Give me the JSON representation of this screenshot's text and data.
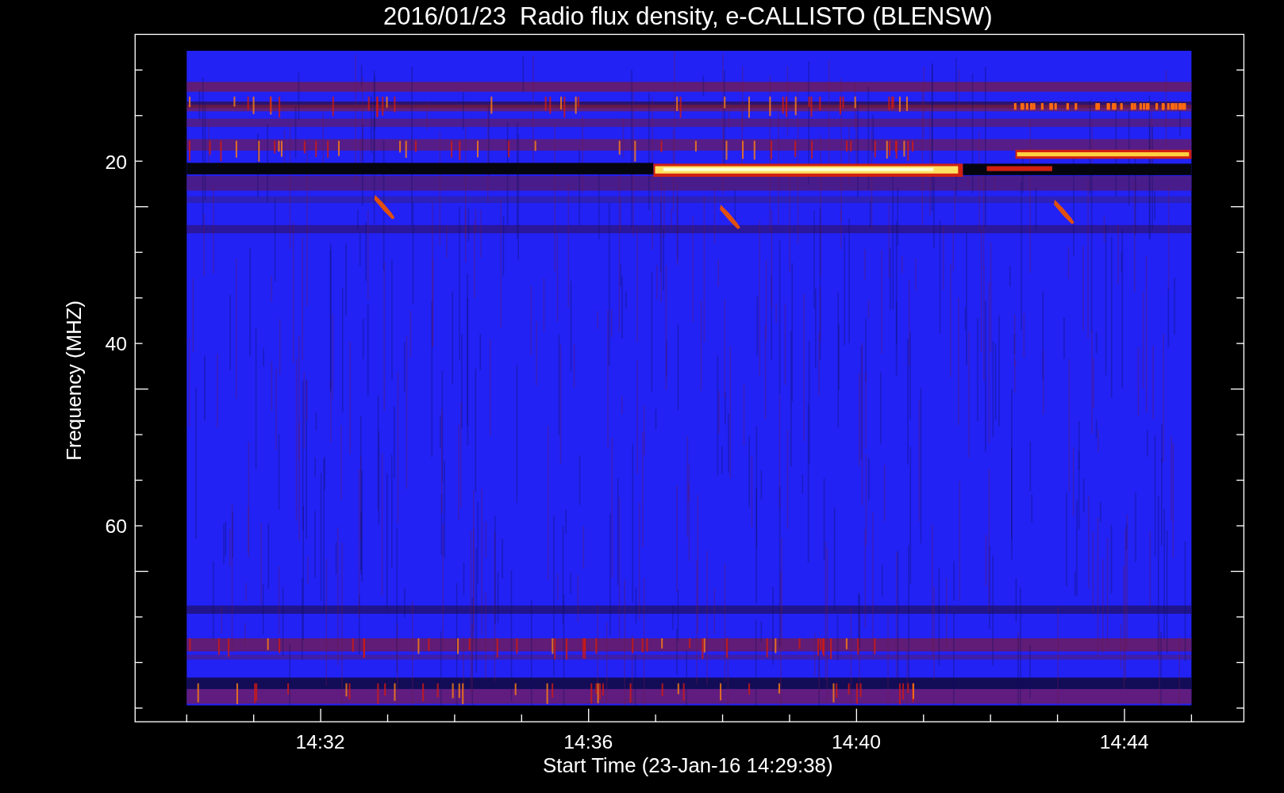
{
  "title": "2016/01/23  Radio flux density, e-CALLISTO (BLENSW)",
  "y_axis": {
    "label": "Frequency (MHZ)",
    "ticks": [
      "20",
      "40",
      "60"
    ]
  },
  "x_axis": {
    "label": "Start Time (23-Jan-16 14:29:38)",
    "ticks": [
      "14:32",
      "14:36",
      "14:40",
      "14:44"
    ]
  }
}
